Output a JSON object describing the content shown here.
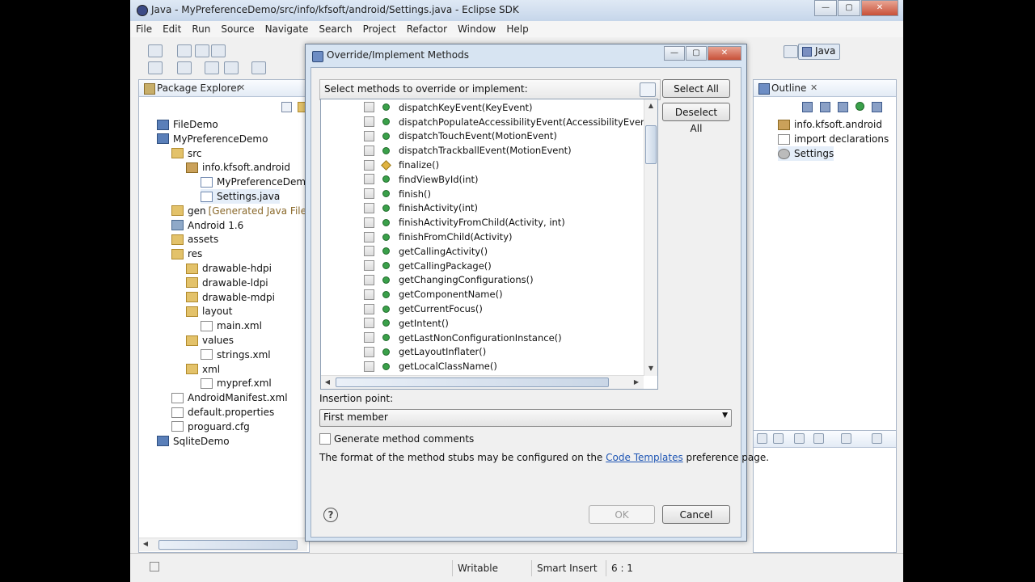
{
  "window": {
    "title": "Java - MyPreferenceDemo/src/info/kfsoft/android/Settings.java - Eclipse SDK",
    "min_glyph": "—",
    "max_glyph": "▢",
    "close_glyph": "✕"
  },
  "menu": [
    "File",
    "Edit",
    "Run",
    "Source",
    "Navigate",
    "Search",
    "Project",
    "Refactor",
    "Window",
    "Help"
  ],
  "perspective": {
    "label": "Java"
  },
  "package_explorer": {
    "tab_label": "Package Explorer",
    "tree": [
      {
        "label": "FileDemo",
        "icon": "project-icon",
        "depth": 0
      },
      {
        "label": "MyPreferenceDemo",
        "icon": "project-icon",
        "depth": 0
      },
      {
        "label": "src",
        "icon": "folder-icon",
        "depth": 1
      },
      {
        "label": "info.kfsoft.android",
        "icon": "package-icon",
        "depth": 2
      },
      {
        "label": "MyPreferenceDemo.j",
        "icon": "java-file-icon",
        "depth": 3
      },
      {
        "label": "Settings.java",
        "icon": "java-file-icon",
        "depth": 3,
        "selected": true
      },
      {
        "label": "gen",
        "icon": "folder-icon",
        "depth": 1,
        "suffix": "[Generated Java Files]"
      },
      {
        "label": "Android 1.6",
        "icon": "library-icon",
        "depth": 1
      },
      {
        "label": "assets",
        "icon": "folder-icon",
        "depth": 1
      },
      {
        "label": "res",
        "icon": "folder-icon",
        "depth": 1
      },
      {
        "label": "drawable-hdpi",
        "icon": "folder-icon",
        "depth": 2
      },
      {
        "label": "drawable-ldpi",
        "icon": "folder-icon",
        "depth": 2
      },
      {
        "label": "drawable-mdpi",
        "icon": "folder-icon",
        "depth": 2
      },
      {
        "label": "layout",
        "icon": "folder-icon",
        "depth": 2
      },
      {
        "label": "main.xml",
        "icon": "xml-file-icon",
        "depth": 3
      },
      {
        "label": "values",
        "icon": "folder-icon",
        "depth": 2
      },
      {
        "label": "strings.xml",
        "icon": "xml-file-icon",
        "depth": 3
      },
      {
        "label": "xml",
        "icon": "folder-icon",
        "depth": 2
      },
      {
        "label": "mypref.xml",
        "icon": "xml-file-icon",
        "depth": 3
      },
      {
        "label": "AndroidManifest.xml",
        "icon": "xml-file-icon",
        "depth": 1
      },
      {
        "label": "default.properties",
        "icon": "file-icon",
        "depth": 1
      },
      {
        "label": "proguard.cfg",
        "icon": "file-icon",
        "depth": 1
      },
      {
        "label": "SqliteDemo",
        "icon": "project-icon",
        "depth": 0
      }
    ]
  },
  "outline": {
    "tab_label": "Outline",
    "tree": [
      {
        "label": "info.kfsoft.android",
        "icon": "package-icon"
      },
      {
        "label": "import declarations",
        "icon": "import-icon"
      },
      {
        "label": "Settings",
        "icon": "class-icon"
      }
    ]
  },
  "status_bar": {
    "writable": "Writable",
    "insert_mode": "Smart Insert",
    "position": "6 : 1"
  },
  "dialog": {
    "title": "Override/Implement Methods",
    "select_label": "Select methods to override or implement:",
    "select_all": "Select All",
    "deselect_all": "Deselect All",
    "methods": [
      {
        "name": "dispatchKeyEvent(KeyEvent)",
        "icon": "public-method-icon"
      },
      {
        "name": "dispatchPopulateAccessibilityEvent(AccessibilityEvent)",
        "icon": "public-method-icon"
      },
      {
        "name": "dispatchTouchEvent(MotionEvent)",
        "icon": "public-method-icon"
      },
      {
        "name": "dispatchTrackballEvent(MotionEvent)",
        "icon": "public-method-icon"
      },
      {
        "name": "finalize()",
        "icon": "protected-method-icon"
      },
      {
        "name": "findViewById(int)",
        "icon": "public-method-icon"
      },
      {
        "name": "finish()",
        "icon": "public-method-icon"
      },
      {
        "name": "finishActivity(int)",
        "icon": "public-method-icon"
      },
      {
        "name": "finishActivityFromChild(Activity, int)",
        "icon": "public-method-icon"
      },
      {
        "name": "finishFromChild(Activity)",
        "icon": "public-method-icon"
      },
      {
        "name": "getCallingActivity()",
        "icon": "public-method-icon"
      },
      {
        "name": "getCallingPackage()",
        "icon": "public-method-icon"
      },
      {
        "name": "getChangingConfigurations()",
        "icon": "public-method-icon"
      },
      {
        "name": "getComponentName()",
        "icon": "public-method-icon"
      },
      {
        "name": "getCurrentFocus()",
        "icon": "public-method-icon"
      },
      {
        "name": "getIntent()",
        "icon": "public-method-icon"
      },
      {
        "name": "getLastNonConfigurationInstance()",
        "icon": "public-method-icon"
      },
      {
        "name": "getLayoutInflater()",
        "icon": "public-method-icon"
      },
      {
        "name": "getLocalClassName()",
        "icon": "public-method-icon"
      }
    ],
    "insertion_label": "Insertion point:",
    "insertion_value": "First member",
    "generate_comments": "Generate method comments",
    "format_text_before": "The format of the method stubs may be configured on the",
    "format_link": "Code Templates",
    "format_text_after": "preference page.",
    "ok": "OK",
    "cancel": "Cancel",
    "help_glyph": "?"
  }
}
